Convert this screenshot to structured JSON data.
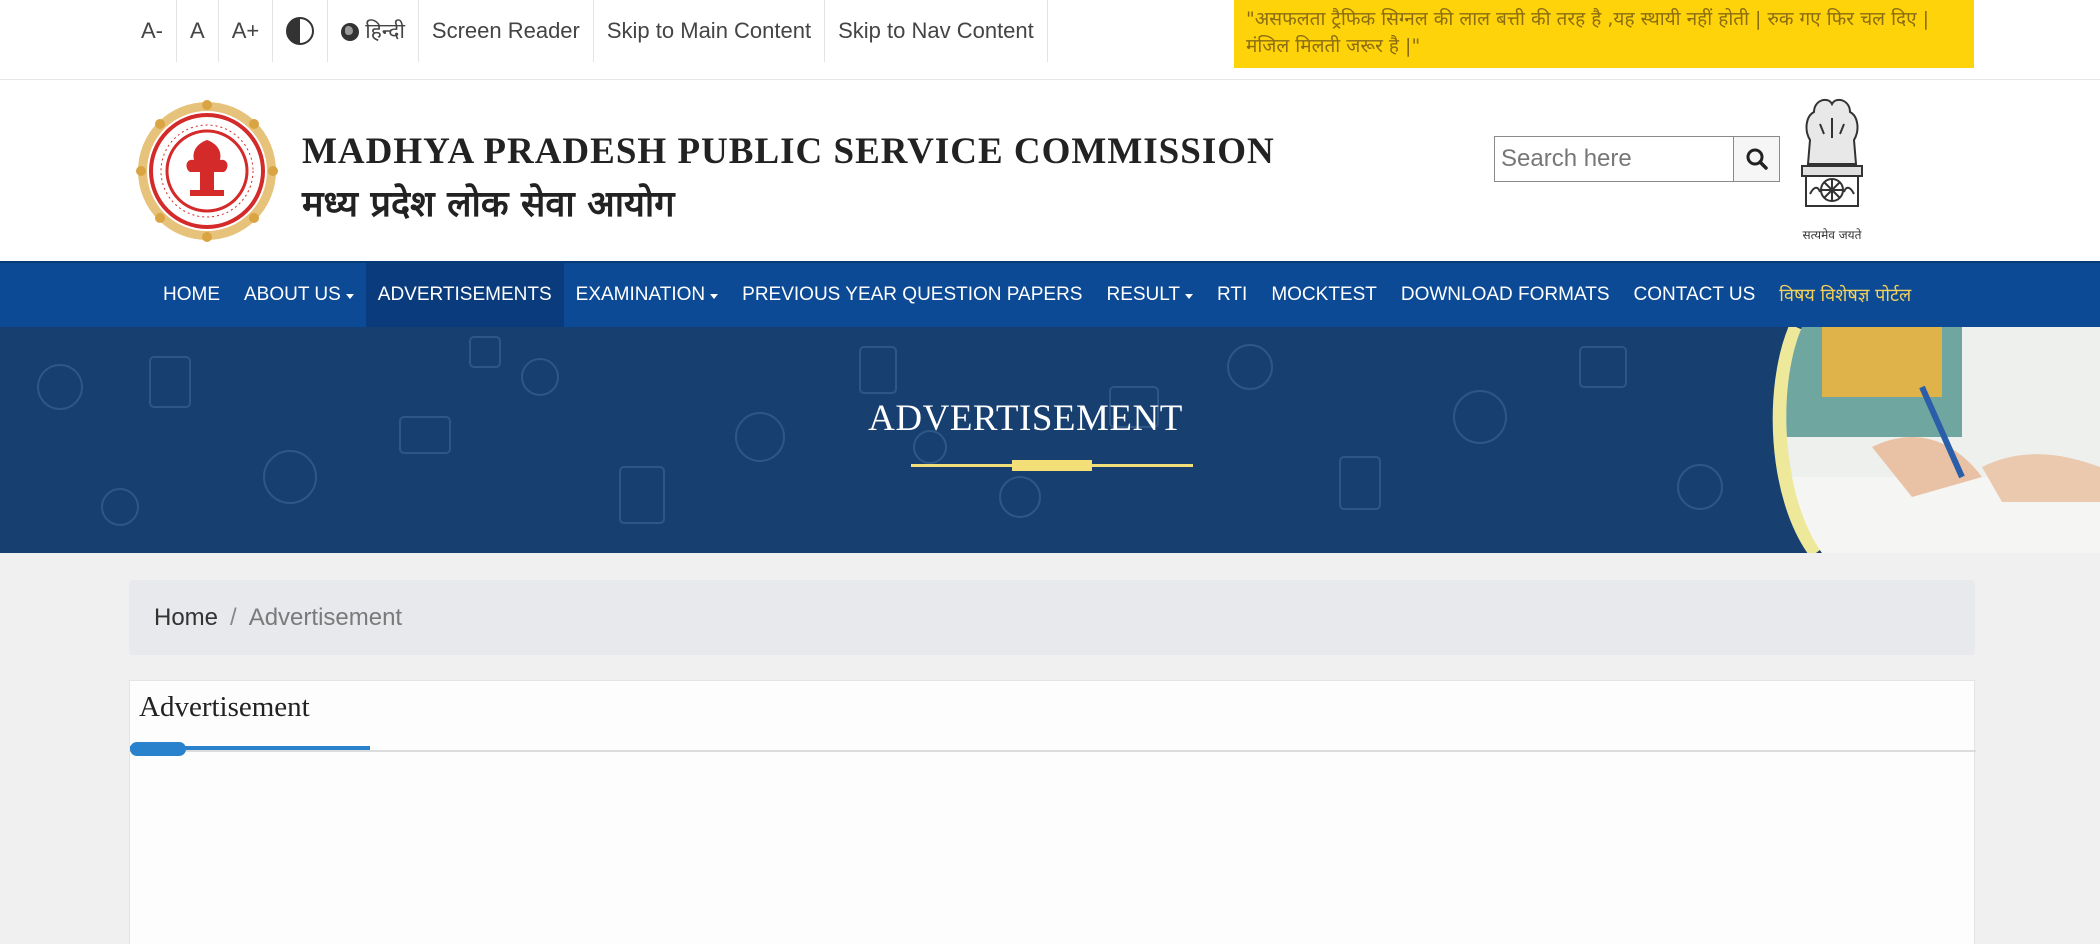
{
  "utility_bar": {
    "font_decrease": "A-",
    "font_normal": "A",
    "font_increase": "A+",
    "contrast_icon": "contrast-icon",
    "language": "हिन्दी",
    "screen_reader": "Screen Reader",
    "skip_main": "Skip to Main Content",
    "skip_nav": "Skip to Nav Content"
  },
  "quote": "\"असफलता ट्रैफिक सिग्नल की लाल बत्ती की तरह है ,यह स्थायी नहीं होती | रुक गए फिर चल दिए | मंजिल मिलती जरूर है |\"",
  "header": {
    "title_en": "MADHYA PRADESH PUBLIC SERVICE COMMISSION",
    "title_hi": "मध्य प्रदेश लोक सेवा आयोग",
    "search_placeholder": "Search here",
    "emblem_caption": "सत्यमेव जयते"
  },
  "nav": {
    "items": [
      {
        "label": "HOME",
        "dropdown": false
      },
      {
        "label": "ABOUT US",
        "dropdown": true
      },
      {
        "label": "ADVERTISEMENTS",
        "dropdown": false,
        "active": true
      },
      {
        "label": "EXAMINATION",
        "dropdown": true
      },
      {
        "label": "PREVIOUS YEAR QUESTION PAPERS",
        "dropdown": false
      },
      {
        "label": "RESULT",
        "dropdown": true
      },
      {
        "label": "RTI",
        "dropdown": false
      },
      {
        "label": "MOCKTEST",
        "dropdown": false
      },
      {
        "label": "DOWNLOAD FORMATS",
        "dropdown": false
      },
      {
        "label": "CONTACT US",
        "dropdown": false
      },
      {
        "label": "विषय विशेषज्ञ पोर्टल",
        "dropdown": false
      }
    ]
  },
  "banner": {
    "title": "ADVERTISEMENT"
  },
  "breadcrumb": {
    "home": "Home",
    "separator": "/",
    "current": "Advertisement"
  },
  "card": {
    "title": "Advertisement"
  },
  "colors": {
    "nav_bg": "#0c4a96",
    "banner_bg": "#173f70",
    "quote_bg": "#ffd30a",
    "accent_blue": "#2a82cc",
    "portal_link": "#f2d15c"
  }
}
